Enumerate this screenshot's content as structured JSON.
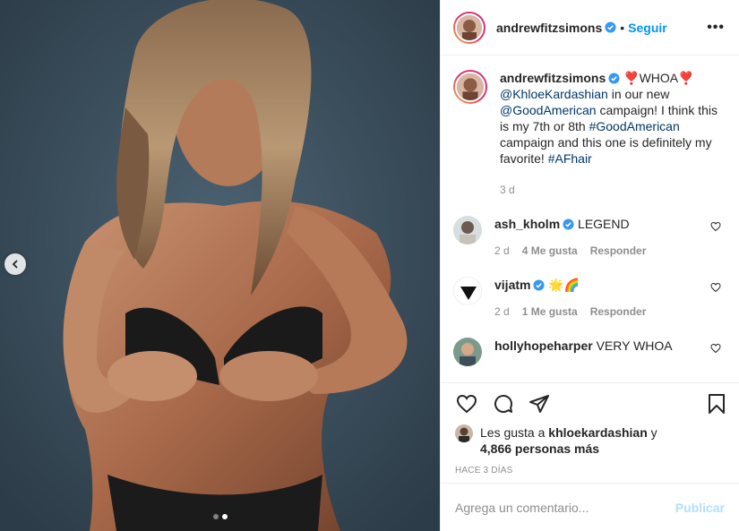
{
  "post": {
    "author": "andrewfitzsimons",
    "follow_label": "Seguir",
    "more_label": "•••"
  },
  "caption": {
    "author": "andrewfitzsimons",
    "emoji_a": "❣️",
    "headline": "WHOA",
    "emoji_b": "❣️",
    "mention_1": "@KhloeKardashian",
    "text_1": " in our new ",
    "mention_2": "@GoodAmerican",
    "text_2": " campaign! I think this is my 7th or 8th ",
    "hashtag_1": "#GoodAmerican",
    "text_3": " campaign and this one is definitely my favorite! ",
    "hashtag_2": "#AFhair",
    "time": "3 d"
  },
  "comments": [
    {
      "user": "ash_kholm",
      "verified": true,
      "text": "LEGEND",
      "time": "2 d",
      "likes": "4 Me gusta",
      "reply": "Responder"
    },
    {
      "user": "vijatm",
      "verified": true,
      "text": "🌟🌈",
      "time": "2 d",
      "likes": "1 Me gusta",
      "reply": "Responder"
    },
    {
      "user": "hollyhopeharper",
      "verified": false,
      "text": "VERY WHOA"
    }
  ],
  "likes": {
    "prefix": "Les gusta a ",
    "user": "khloekardashian",
    "suffix": " y",
    "count": "4,866 personas más"
  },
  "posted_ago": "HACE 3 DÍAS",
  "comment_box": {
    "placeholder": "Agrega un comentario...",
    "publish_label": "Publicar"
  },
  "carousel": {
    "slide_count": 2,
    "active_index": 1
  },
  "colors": {
    "accent": "#0095f6",
    "link": "#00376b",
    "muted": "#8e8e8e",
    "publish_disabled": "#b2dffc"
  },
  "icons": [
    "chevron-left-icon",
    "verified-icon",
    "more-icon",
    "heart-icon",
    "comment-icon",
    "share-icon",
    "bookmark-icon"
  ]
}
